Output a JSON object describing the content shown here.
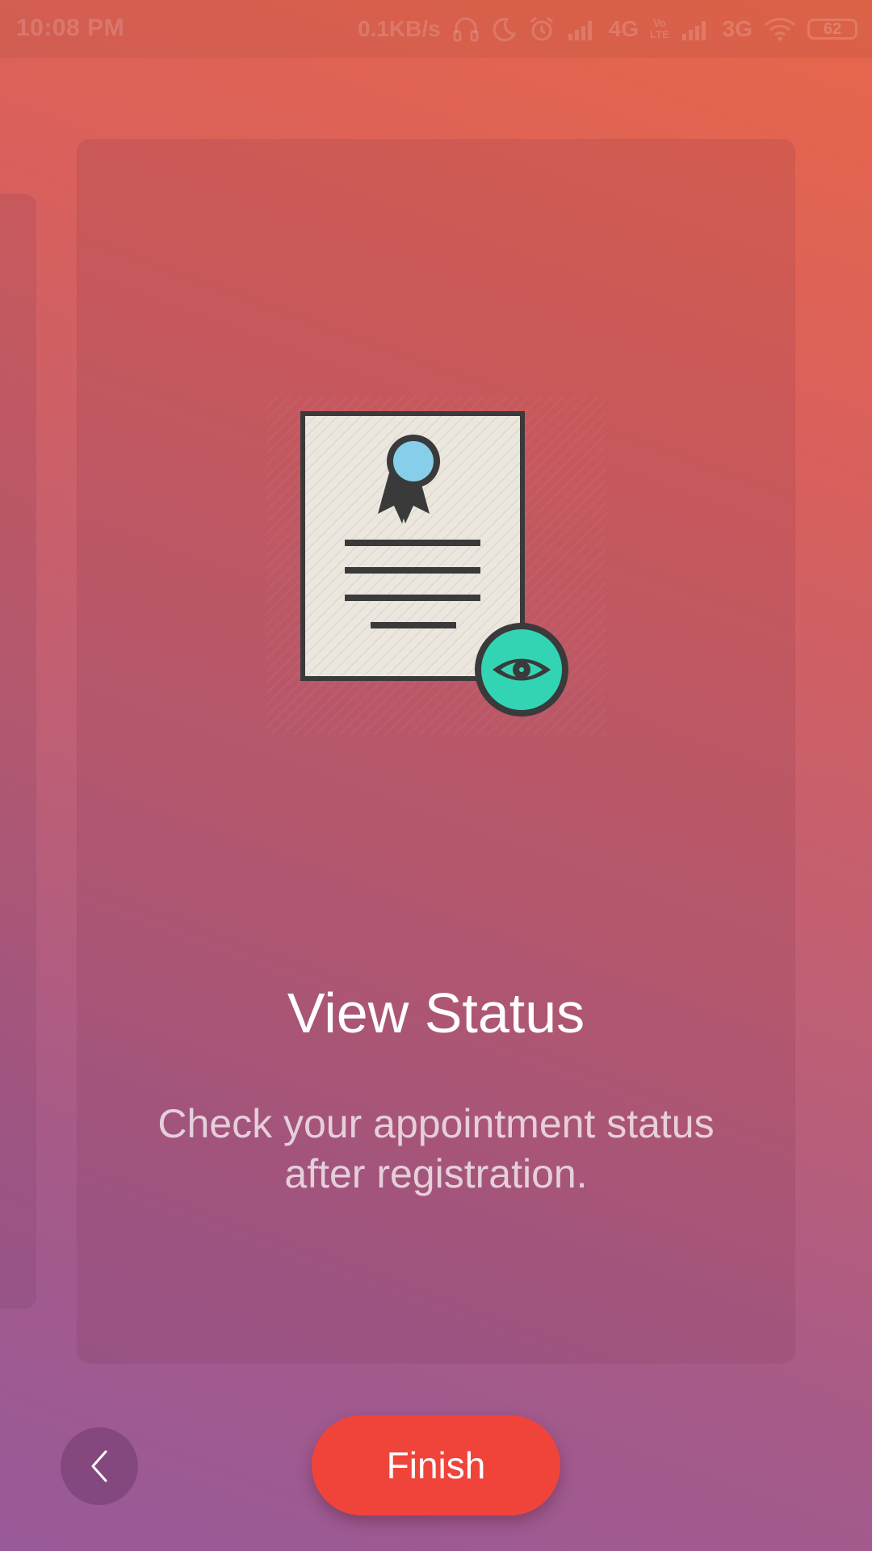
{
  "status_bar": {
    "time": "10:08 PM",
    "network_speed": "0.1KB/s",
    "network_1": "4G",
    "volte_top": "Vo",
    "volte_bottom": "LTE",
    "network_2": "3G",
    "battery": "62",
    "icons": [
      "headset-icon",
      "moon-icon",
      "alarm-icon",
      "signal-icon",
      "signal-icon",
      "wifi-icon",
      "battery-icon"
    ]
  },
  "onboarding": {
    "title": "View Status",
    "description": "Check your appointment status after registration.",
    "illustration": "certificate-with-eye-icon"
  },
  "controls": {
    "back_icon": "chevron-left-icon",
    "finish_label": "Finish",
    "finish_color": "#f0443a"
  },
  "colors": {
    "gradient_top": "#e8674a",
    "gradient_bottom": "#985a98",
    "ribbon_circle": "#87ceeb",
    "eye_badge": "#33d4b4",
    "paper": "#ede8df",
    "outline": "#3a3a3a"
  }
}
